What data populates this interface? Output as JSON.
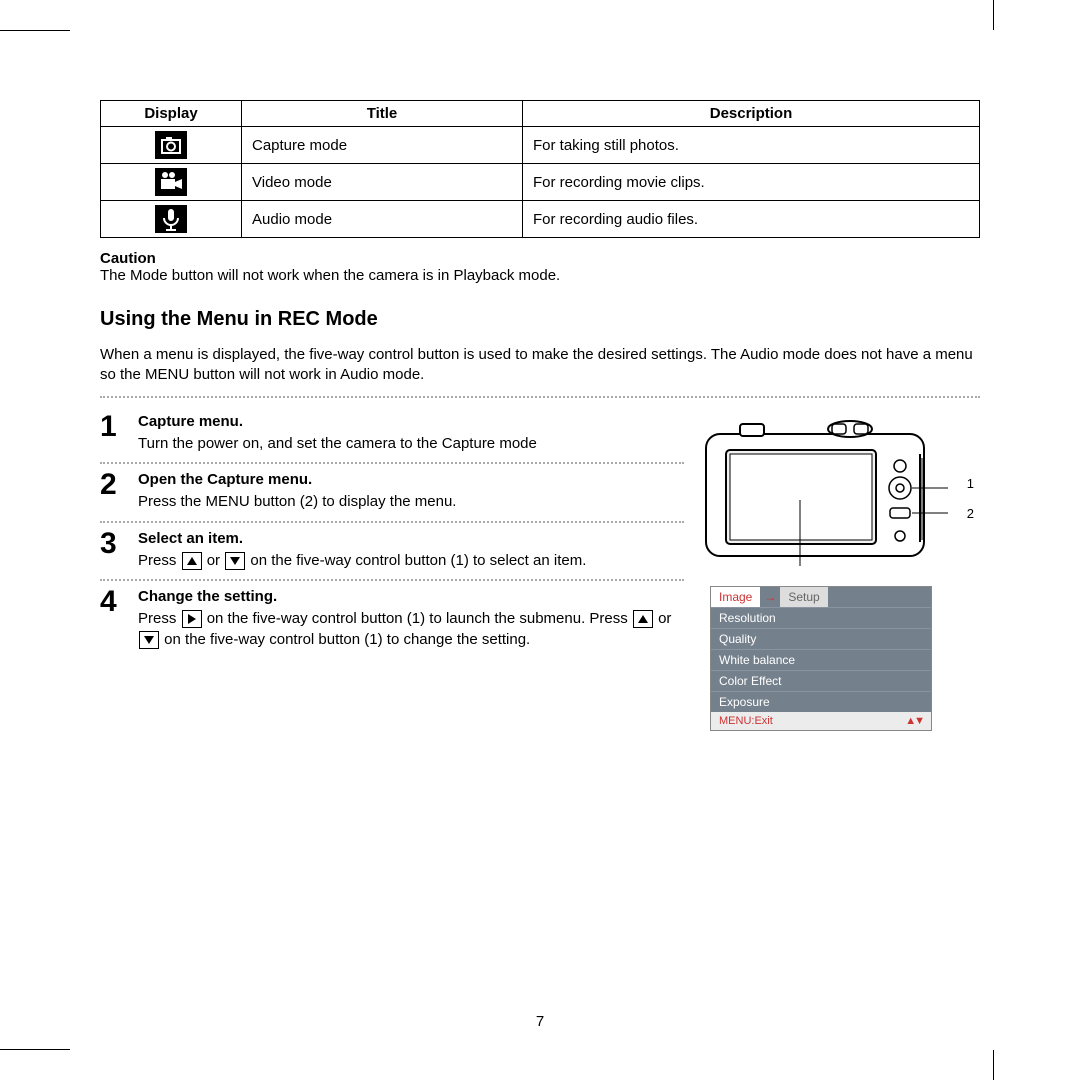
{
  "table": {
    "headers": [
      "Display",
      "Title",
      "Description"
    ],
    "rows": [
      {
        "icon": "camera-icon",
        "title": "Capture mode",
        "desc": "For taking still photos."
      },
      {
        "icon": "video-icon",
        "title": "Video mode",
        "desc": "For recording movie clips."
      },
      {
        "icon": "microphone-icon",
        "title": "Audio mode",
        "desc": "For recording audio files."
      }
    ]
  },
  "caution": {
    "label": "Caution",
    "text": "The Mode button will not work when the camera is in Playback mode."
  },
  "section": {
    "heading": "Using the Menu in REC Mode",
    "intro": "When a menu is displayed, the five-way control button is used to make the desired settings. The Audio mode does not have a menu so the MENU button will not work in Audio mode."
  },
  "steps": [
    {
      "num": "1",
      "title": "Capture menu.",
      "text": "Turn the power on, and set the camera to the Capture mode"
    },
    {
      "num": "2",
      "title": "Open the Capture menu.",
      "text": "Press the MENU button (2) to display the menu."
    },
    {
      "num": "3",
      "title": "Select an item.",
      "text_a": "Press ",
      "text_b": " or ",
      "text_c": " on the five-way control button (1) to select an item."
    },
    {
      "num": "4",
      "title": "Change the setting.",
      "text_a": "Press ",
      "text_b": " on the five-way control button (1) to launch the submenu. Press ",
      "text_c": " or ",
      "text_d": " on the five-way control button (1) to change the setting."
    }
  ],
  "figure": {
    "callouts": [
      "1",
      "2"
    ]
  },
  "osd": {
    "tabs": [
      "Image",
      "Setup"
    ],
    "items": [
      "Resolution",
      "Quality",
      "White balance",
      "Color Effect",
      "Exposure"
    ],
    "footer": "MENU:Exit"
  },
  "page_number": "7"
}
